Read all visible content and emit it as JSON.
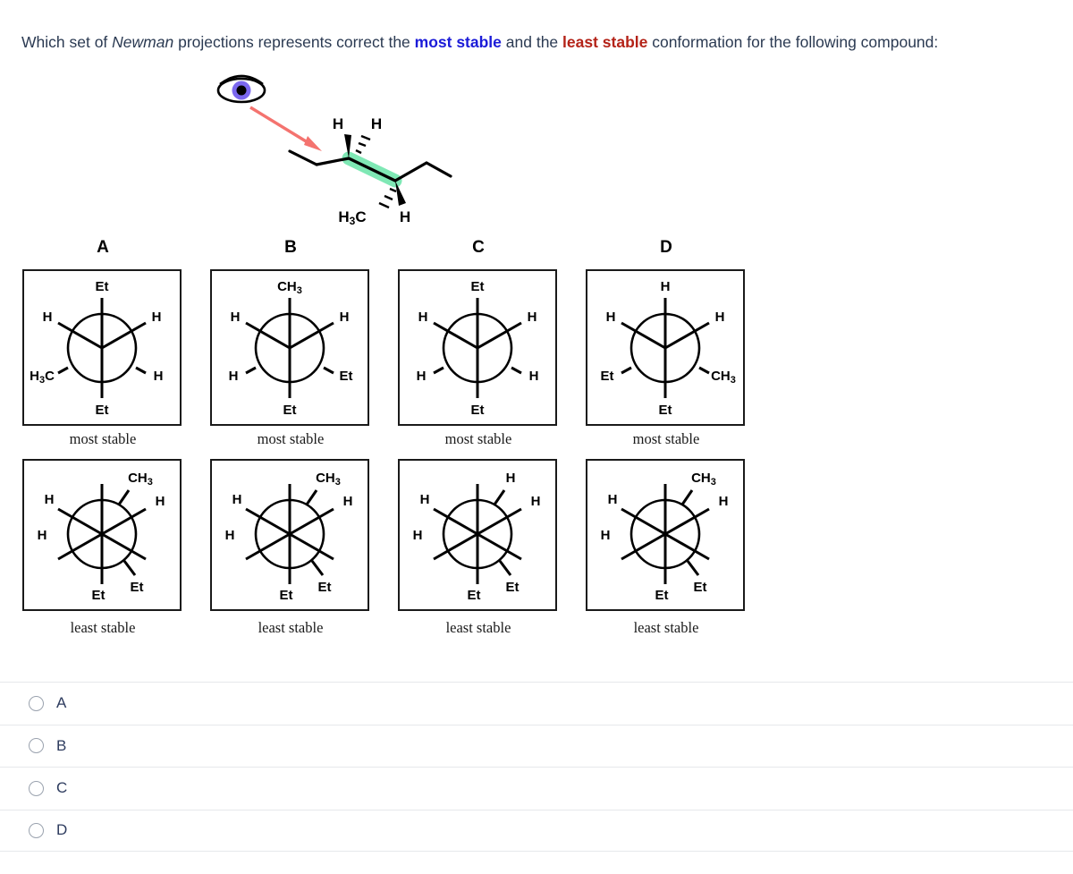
{
  "question": {
    "part1": "Which set of ",
    "emphasis_italic": "Newman",
    "part2": " projections represents correct the ",
    "most_stable": "most stable",
    "part3": " and the ",
    "least_stable": "least stable",
    "part4": " conformation for the following compound:",
    "colors": {
      "body": "#2b3a52",
      "most_stable": "#1b1bd8",
      "least_stable": "#b42318"
    }
  },
  "molecule": {
    "eye_icon": "eye-icon",
    "arrow_icon": "view-direction-arrow",
    "arrow_color": "#f4736f",
    "highlight_color": "#7fe8b5",
    "labels": {
      "front_top_left": "H",
      "front_top_right": "H",
      "back_bottom_left": "H3C",
      "back_bottom_right": "H"
    }
  },
  "columns": [
    {
      "label": "A",
      "most_stable": {
        "caption": "most stable",
        "type": "staggered",
        "front": {
          "up": "Et",
          "lower_left": "H3C",
          "lower_right": "H"
        },
        "back": {
          "down": "Et",
          "upper_left": "H",
          "upper_right": "H"
        }
      },
      "least_stable": {
        "caption": "least stable",
        "type": "eclipsed",
        "front": {
          "up_left": "H",
          "left": "H",
          "down": "Et"
        },
        "back": {
          "up_right": "CH3",
          "right": "H",
          "down_right": "Et"
        }
      }
    },
    {
      "label": "B",
      "most_stable": {
        "caption": "most stable",
        "type": "staggered",
        "front": {
          "up": "CH3",
          "lower_left": "H",
          "lower_right": "Et"
        },
        "back": {
          "down": "Et",
          "upper_left": "H",
          "upper_right": "H"
        }
      },
      "least_stable": {
        "caption": "least stable",
        "type": "eclipsed",
        "front": {
          "up_left": "H",
          "left": "H",
          "down": "Et"
        },
        "back": {
          "up_right": "CH3",
          "right": "H",
          "down_right": "Et"
        }
      }
    },
    {
      "label": "C",
      "most_stable": {
        "caption": "most stable",
        "type": "staggered",
        "front": {
          "up": "Et",
          "lower_left": "H",
          "lower_right": "H"
        },
        "back": {
          "down": "Et",
          "upper_left": "H",
          "upper_right": "H"
        }
      },
      "least_stable": {
        "caption": "least stable",
        "type": "eclipsed",
        "front": {
          "up_left": "H",
          "left": "H",
          "down": "Et"
        },
        "back": {
          "up_right": "H",
          "right": "H",
          "down_right": "Et"
        }
      }
    },
    {
      "label": "D",
      "most_stable": {
        "caption": "most stable",
        "type": "staggered",
        "front": {
          "up": "H",
          "lower_left": "Et",
          "lower_right": "CH3"
        },
        "back": {
          "down": "Et",
          "upper_left": "H",
          "upper_right": "H"
        }
      },
      "least_stable": {
        "caption": "least stable",
        "type": "eclipsed",
        "front": {
          "up_left": "H",
          "left": "H",
          "down": "Et"
        },
        "back": {
          "up_right": "CH3",
          "right": "H",
          "down_right": "Et"
        }
      }
    }
  ],
  "options": [
    {
      "label": "A",
      "selected": false
    },
    {
      "label": "B",
      "selected": false
    },
    {
      "label": "C",
      "selected": false
    },
    {
      "label": "D",
      "selected": false
    }
  ]
}
